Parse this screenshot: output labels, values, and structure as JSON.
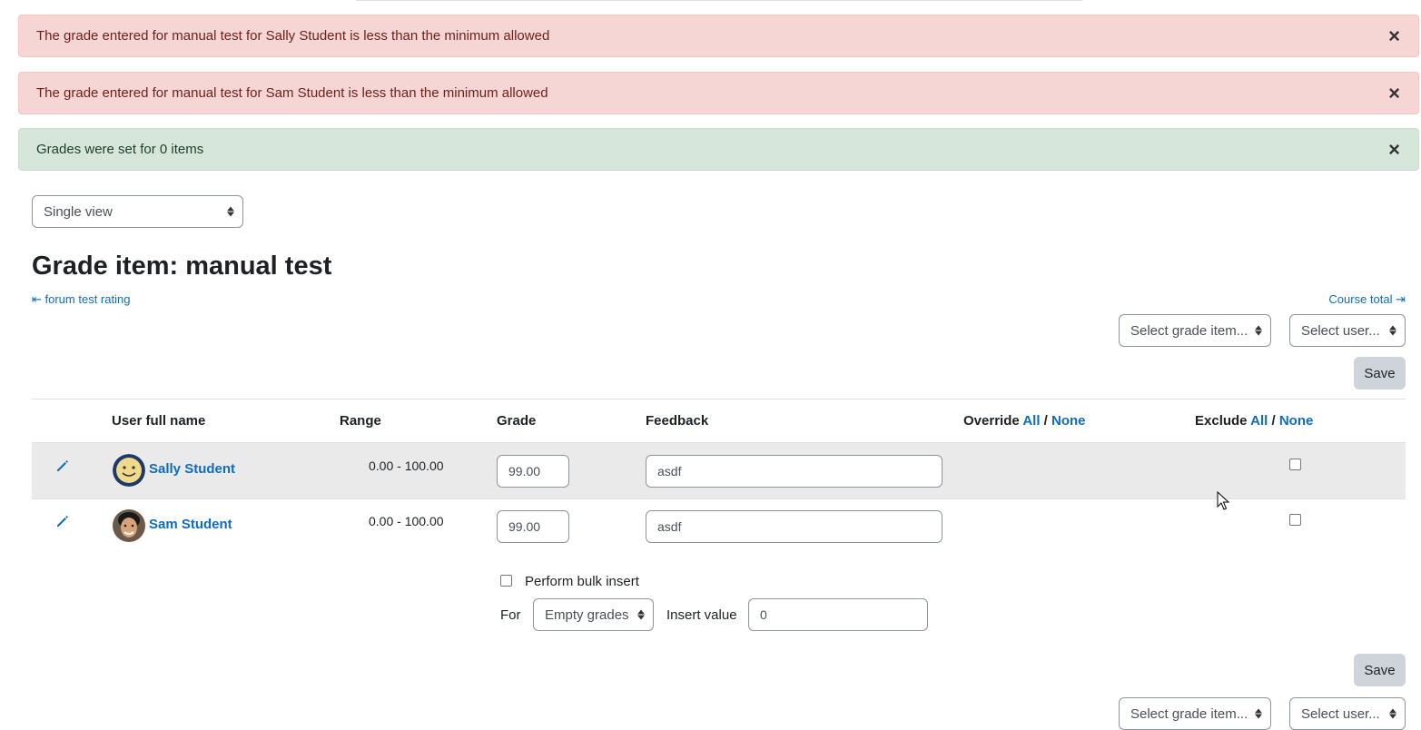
{
  "alerts": [
    {
      "type": "danger",
      "text": "The grade entered for manual test for Sally Student is less than the minimum allowed"
    },
    {
      "type": "danger",
      "text": "The grade entered for manual test for Sam Student is less than the minimum allowed"
    },
    {
      "type": "success",
      "text": "Grades were set for 0 items"
    }
  ],
  "close_glyph": "×",
  "view_select": {
    "value": "Single view"
  },
  "page_title": "Grade item: manual test",
  "nav": {
    "prev": "⇤ forum test rating",
    "next": "Course total ⇥"
  },
  "selectors": {
    "grade_item": "Select grade item...",
    "user": "Select user..."
  },
  "save_label": "Save",
  "table": {
    "headers": {
      "name": "User full name",
      "range": "Range",
      "grade": "Grade",
      "feedback": "Feedback",
      "override": "Override",
      "exclude": "Exclude",
      "all": "All",
      "slash": "/",
      "none": "None"
    },
    "rows": [
      {
        "name": "Sally Student",
        "range": "0.00 - 100.00",
        "grade": "99.00",
        "feedback": "asdf"
      },
      {
        "name": "Sam Student",
        "range": "0.00 - 100.00",
        "grade": "99.00",
        "feedback": "asdf"
      }
    ]
  },
  "bulk": {
    "checkbox_label": "Perform bulk insert",
    "for_label": "For",
    "for_value": "Empty grades",
    "insert_label": "Insert value",
    "insert_value": "0"
  },
  "colors": {
    "link": "#0f6cbf",
    "danger_bg": "#f6d6d4",
    "success_bg": "#d7e6da",
    "row_highlight": "#eaeaea",
    "button": "#ced4da"
  },
  "icons": {
    "edit": "pencil-icon",
    "close": "close-icon",
    "select": "select-arrows-icon",
    "cursor": "mouse-pointer-icon"
  }
}
